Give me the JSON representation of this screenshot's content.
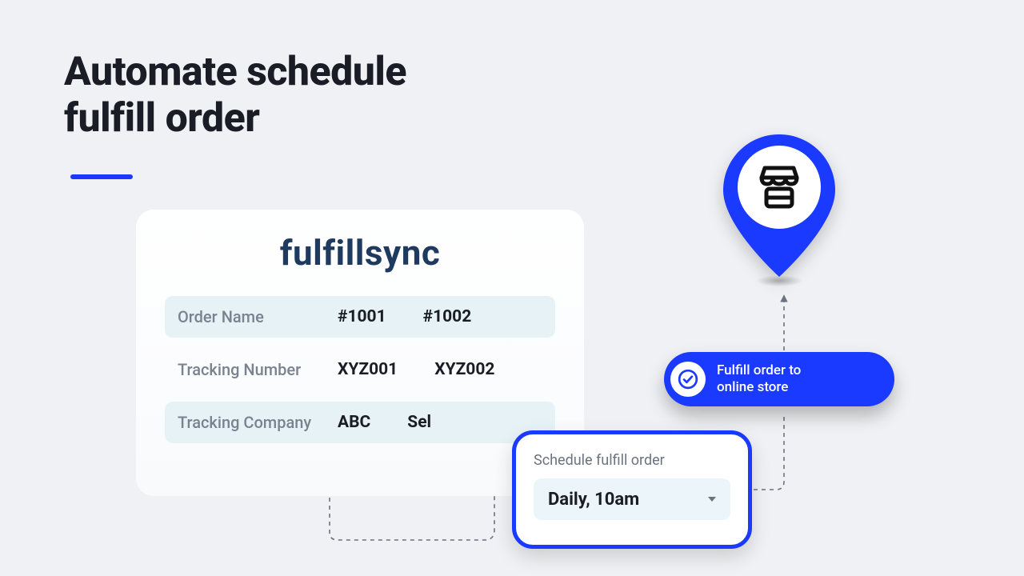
{
  "title": "Automate schedule\nfulfill order",
  "card": {
    "brand": "fulfillsync",
    "rows": {
      "order_name": {
        "label": "Order Name",
        "v1": "#1001",
        "v2": "#1002"
      },
      "tracking_number": {
        "label": "Tracking Number",
        "v1": "XYZ001",
        "v2": "XYZ002"
      },
      "tracking_company": {
        "label": "Tracking Company",
        "v1": "ABC",
        "v2": "Sel"
      }
    }
  },
  "schedule": {
    "label": "Schedule fulfill order",
    "value": "Daily, 10am"
  },
  "pill": {
    "text": "Fulfill order to\nonline store"
  }
}
